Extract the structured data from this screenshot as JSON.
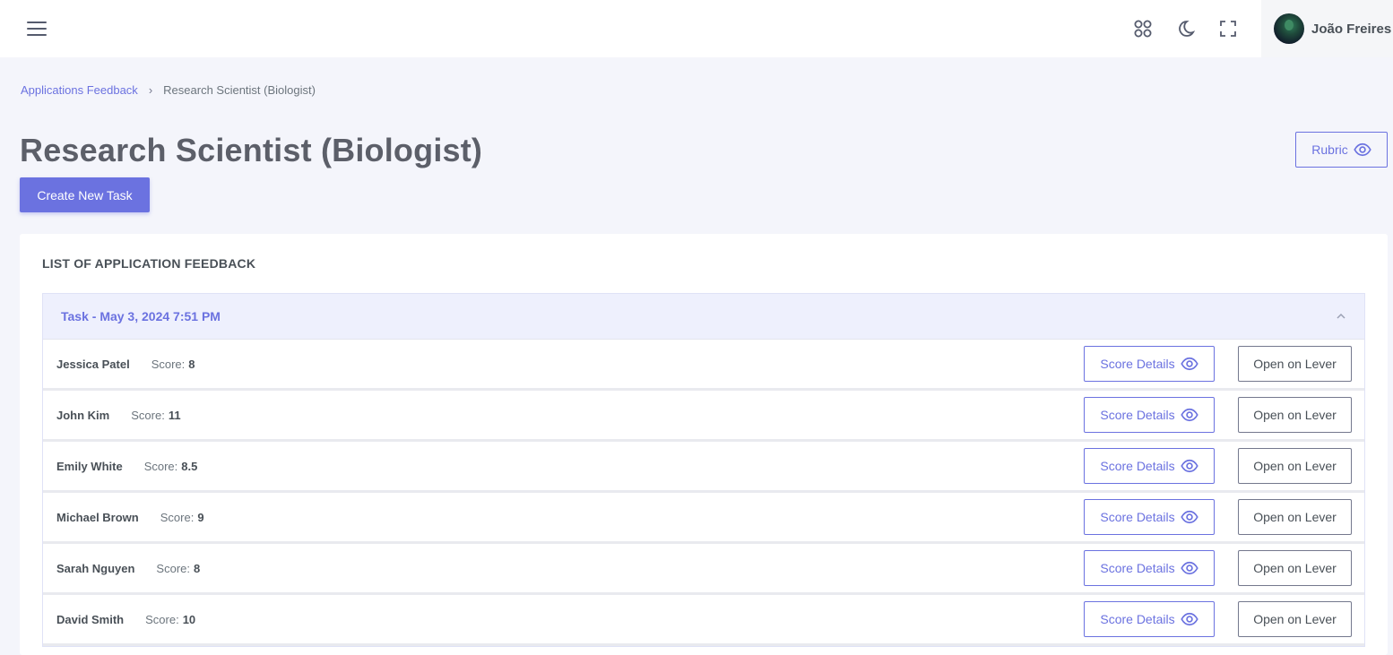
{
  "topbar": {
    "icons": [
      "menu-icon",
      "apps-icon",
      "moon-icon",
      "fullscreen-icon"
    ],
    "user_name": "João Freires"
  },
  "breadcrumb": {
    "parent": "Applications Feedback",
    "current": "Research Scientist (Biologist)"
  },
  "page": {
    "title": "Research Scientist (Biologist)",
    "rubric_label": "Rubric",
    "create_label": "Create New Task"
  },
  "card": {
    "title": "LIST OF APPLICATION FEEDBACK",
    "task": {
      "label": "Task - May 3, 2024 7:51 PM",
      "expanded": true,
      "rows": [
        {
          "name": "Jessica Patel",
          "score_label": "Score:",
          "score": "8",
          "details_label": "Score Details",
          "lever_label": "Open on Lever"
        },
        {
          "name": "John Kim",
          "score_label": "Score:",
          "score": "11",
          "details_label": "Score Details",
          "lever_label": "Open on Lever"
        },
        {
          "name": "Emily White",
          "score_label": "Score:",
          "score": "8.5",
          "details_label": "Score Details",
          "lever_label": "Open on Lever"
        },
        {
          "name": "Michael Brown",
          "score_label": "Score:",
          "score": "9",
          "details_label": "Score Details",
          "lever_label": "Open on Lever"
        },
        {
          "name": "Sarah Nguyen",
          "score_label": "Score:",
          "score": "8",
          "details_label": "Score Details",
          "lever_label": "Open on Lever"
        },
        {
          "name": "David Smith",
          "score_label": "Score:",
          "score": "10",
          "details_label": "Score Details",
          "lever_label": "Open on Lever"
        }
      ]
    }
  },
  "colors": {
    "accent": "#6b72e0",
    "background": "#f4f5fb",
    "accordion_header": "#eef0fd"
  }
}
